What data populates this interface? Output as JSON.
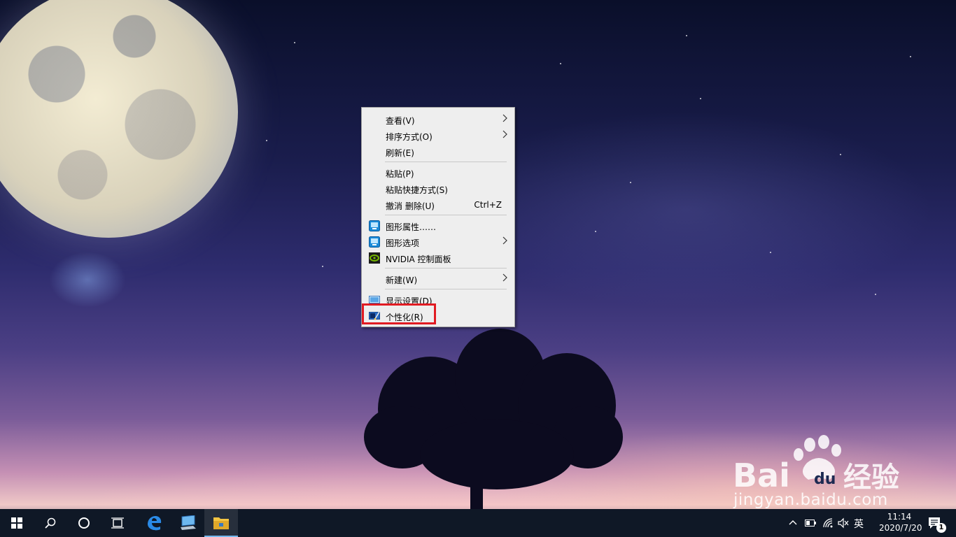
{
  "desktop": {
    "wallpaper": "night sky with full moon and tree silhouette"
  },
  "context_menu": {
    "items": [
      {
        "label": "查看(V)",
        "has_submenu": true
      },
      {
        "label": "排序方式(O)",
        "has_submenu": true
      },
      {
        "label": "刷新(E)"
      },
      {
        "label": "粘贴(P)"
      },
      {
        "label": "粘贴快捷方式(S)"
      },
      {
        "label": "撤消 删除(U)",
        "shortcut": "Ctrl+Z"
      },
      {
        "label": "图形属性……",
        "icon": "intel-graphics-icon"
      },
      {
        "label": "图形选项",
        "icon": "intel-graphics-icon",
        "has_submenu": true
      },
      {
        "label": "NVIDIA 控制面板",
        "icon": "nvidia-icon"
      },
      {
        "label": "新建(W)",
        "has_submenu": true
      },
      {
        "label": "显示设置(D)",
        "icon": "display-settings-icon"
      },
      {
        "label": "个性化(R)",
        "icon": "personalize-icon",
        "highlighted": true
      }
    ]
  },
  "watermark": {
    "brand": "Baidu经验",
    "site": "jingyan.baidu.com"
  },
  "taskbar": {
    "apps": [
      {
        "icon": "windows-start-icon"
      },
      {
        "icon": "search-icon"
      },
      {
        "icon": "cortana-icon"
      },
      {
        "icon": "task-view-icon"
      },
      {
        "icon": "edge-icon"
      },
      {
        "icon": "this-pc-icon"
      },
      {
        "icon": "file-explorer-icon",
        "active": true
      }
    ],
    "tray": {
      "ime": "英",
      "time": "11:14",
      "date": "2020/7/20",
      "notification_count": "1"
    }
  },
  "colors": {
    "highlight_box": "#e11b22",
    "taskbar": "#0f1826",
    "menu_bg": "#eeeeee"
  }
}
